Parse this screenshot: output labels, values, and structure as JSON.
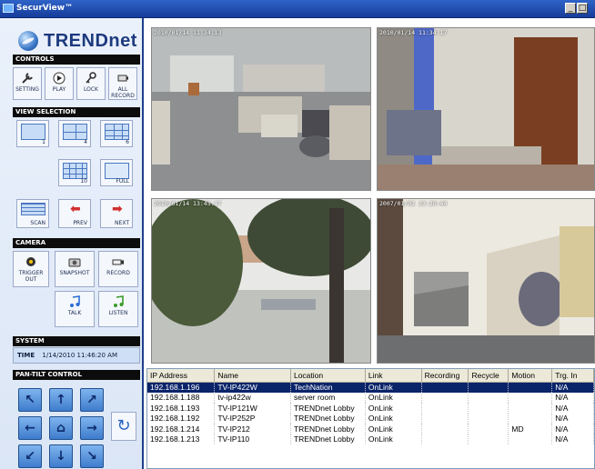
{
  "window": {
    "title": "SecurView™"
  },
  "brand": {
    "logo_text": "TRENDnet"
  },
  "controls": {
    "header": "CONTROLS",
    "buttons": [
      {
        "label": "SETTING",
        "icon": "wrench-icon"
      },
      {
        "label": "PLAY",
        "icon": "play-icon"
      },
      {
        "label": "LOCK",
        "icon": "key-icon"
      },
      {
        "label": "ALL RECORD",
        "icon": "camera-icon"
      }
    ]
  },
  "view_selection": {
    "header": "VIEW SELECTION",
    "layouts": [
      "1",
      "4",
      "6",
      "10",
      "FULL"
    ],
    "scan_label": "SCAN",
    "prev_label": "PREV",
    "next_label": "NEXT"
  },
  "camera": {
    "header": "CAMERA",
    "buttons": [
      {
        "label": "TRIGGER OUT",
        "icon": "trigger-icon"
      },
      {
        "label": "SNAPSHOT",
        "icon": "snapshot-icon"
      },
      {
        "label": "RECORD",
        "icon": "record-camera-icon"
      },
      {
        "label": "TALK",
        "icon": "note-icon"
      },
      {
        "label": "LISTEN",
        "icon": "note-icon"
      }
    ]
  },
  "system": {
    "header": "SYSTEM",
    "time_label": "TIME",
    "time_value": "1/14/2010 11:46:20 AM"
  },
  "pan_tilt": {
    "header": "PAN-TILT CONTROL"
  },
  "feeds": [
    {
      "timestamp": "2010/01/14 11:34:13"
    },
    {
      "timestamp": "2010/01/14 11:34:17"
    },
    {
      "timestamp": "2010/01/14 13:45:17"
    },
    {
      "timestamp": "2007/01/02 23:20:44"
    }
  ],
  "camera_table": {
    "columns": [
      "IP Address",
      "Name",
      "Location",
      "Link",
      "Recording",
      "Recycle",
      "Motion",
      "Trg. In"
    ],
    "rows": [
      [
        "192.168.1.196",
        "TV-IP422W",
        "TechNation",
        "OnLink",
        "",
        "",
        "",
        "N/A"
      ],
      [
        "192.168.1.188",
        "tv-ip422w",
        "server room",
        "OnLink",
        "",
        "",
        "",
        "N/A"
      ],
      [
        "192.168.1.193",
        "TV-IP121W",
        "TRENDnet Lobby",
        "OnLink",
        "",
        "",
        "",
        "N/A"
      ],
      [
        "192.168.1.192",
        "TV-IP252P",
        "TRENDnet Lobby",
        "OnLink",
        "",
        "",
        "",
        "N/A"
      ],
      [
        "192.168.1.214",
        "TV-IP212",
        "TRENDnet Lobby",
        "OnLink",
        "",
        "",
        "MD",
        "N/A"
      ],
      [
        "192.168.1.213",
        "TV-IP110",
        "TRENDnet Lobby",
        "OnLink",
        "",
        "",
        "",
        "N/A"
      ]
    ],
    "selected_row": 0
  }
}
